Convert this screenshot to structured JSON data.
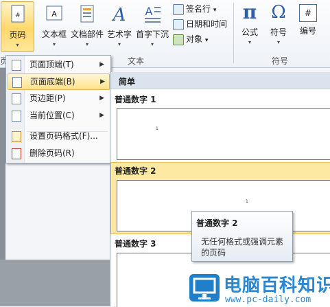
{
  "ribbon": {
    "buttons": [
      {
        "label": "页码"
      },
      {
        "label": "文本框"
      },
      {
        "label": "文档部件"
      },
      {
        "label": "艺术字"
      },
      {
        "label": "首字下沉"
      },
      {
        "label": "公式"
      },
      {
        "label": "符号"
      },
      {
        "label": "编号"
      }
    ],
    "small_items": [
      {
        "label": "签名行",
        "caret": "▾"
      },
      {
        "label": "日期和时间"
      },
      {
        "label": "对象",
        "caret": "▾"
      }
    ],
    "groups": {
      "left_fragment": "页",
      "text": "文本",
      "symbols": "符号"
    },
    "symbols_glyphs": {
      "pi": "π",
      "omega": "Ω",
      "hash": "#"
    }
  },
  "menu": {
    "items": [
      {
        "label": "页面顶端(T)",
        "arrow": "▶"
      },
      {
        "label": "页面底端(B)",
        "arrow": "▶"
      },
      {
        "label": "页边距(P)",
        "arrow": "▶"
      },
      {
        "label": "当前位置(C)",
        "arrow": "▶"
      },
      {
        "label": "设置页码格式(F)..."
      },
      {
        "label": "删除页码(R)"
      }
    ],
    "highlighted_index": 1
  },
  "gallery": {
    "header": "简单",
    "items": [
      {
        "title": "普通数字 1",
        "page_number": "1"
      },
      {
        "title": "普通数字 2",
        "page_number": "1"
      },
      {
        "title": "普通数字 3"
      }
    ]
  },
  "tooltip": {
    "title": "普通数字 2",
    "description": "无任何格式或强调元素的页码"
  },
  "watermark": {
    "title": "电脑百科知识",
    "url": "www.pc-daily.com"
  },
  "colors": {
    "highlight": "#ffe28a",
    "accent": "#2a86cf"
  }
}
